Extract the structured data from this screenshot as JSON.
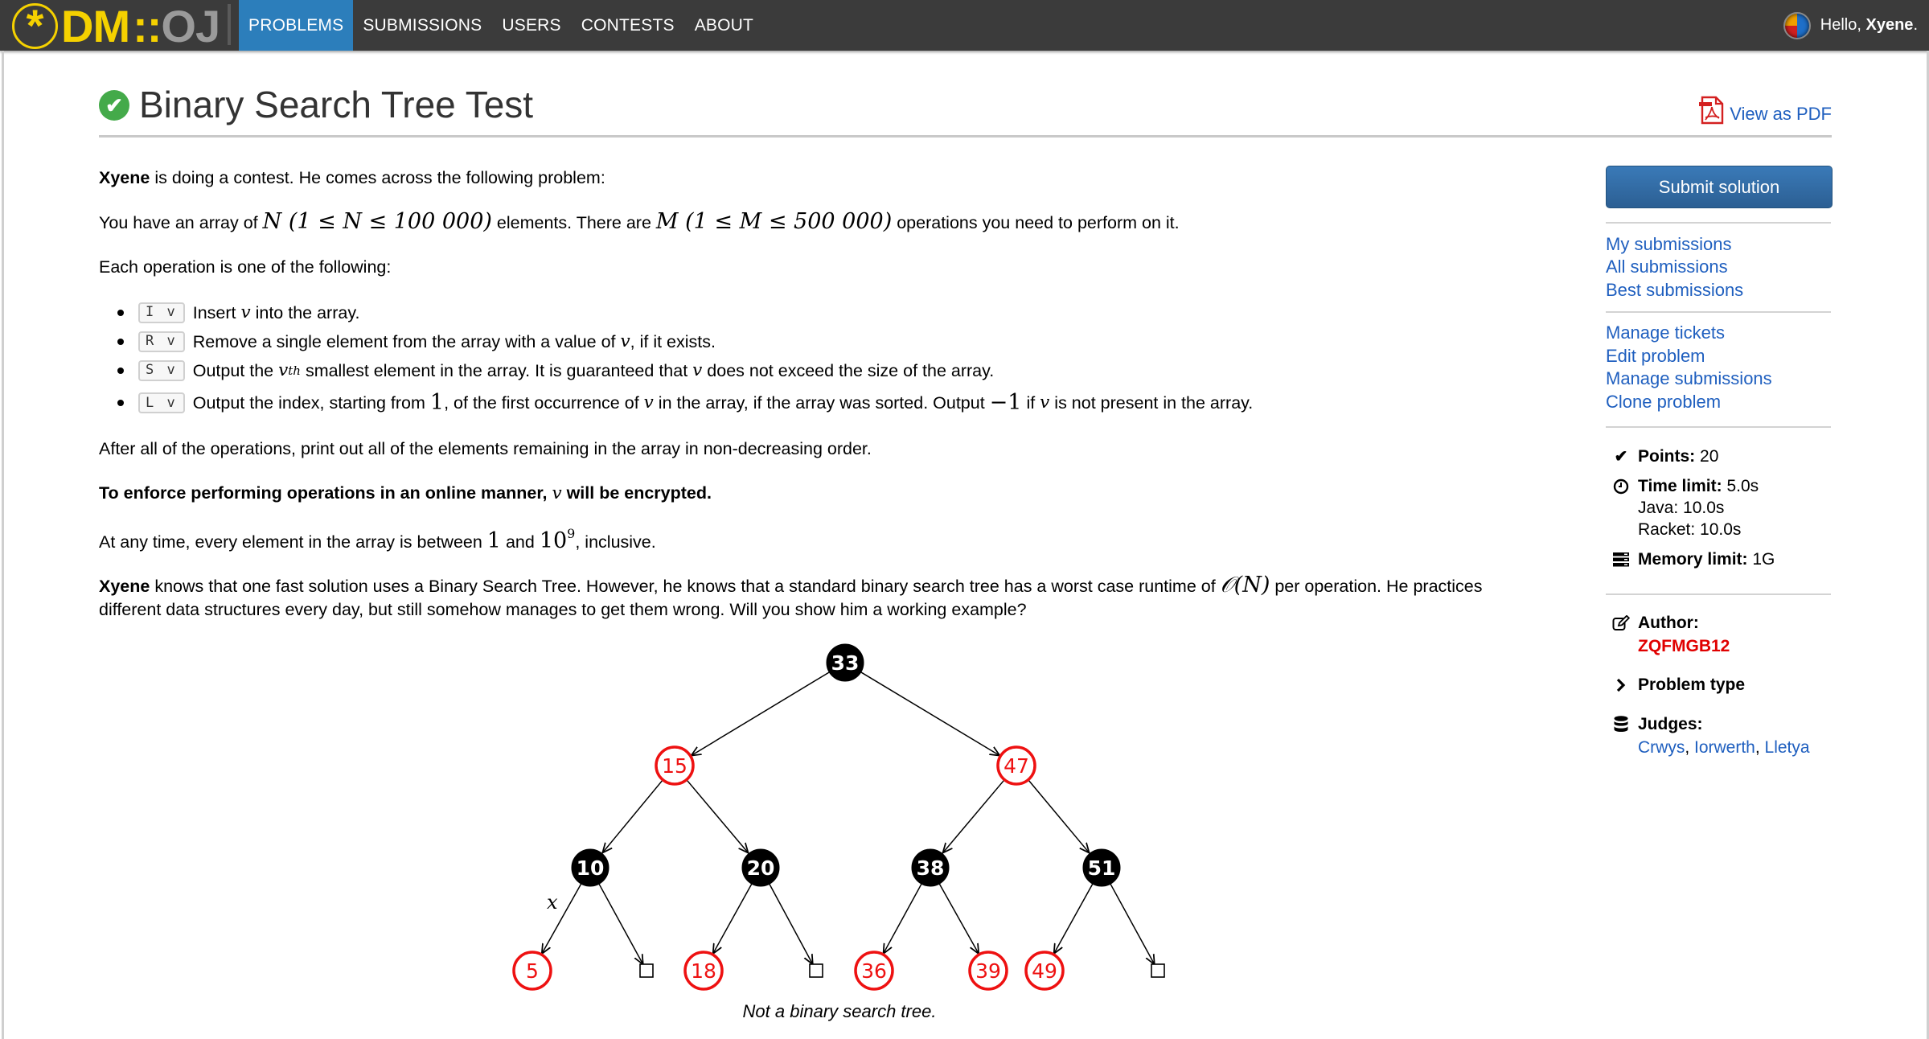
{
  "navbar": {
    "logo": {
      "star": "*",
      "dm": "DM",
      "sep": "::",
      "oj": "OJ"
    },
    "tabs": [
      {
        "label": "PROBLEMS",
        "active": true
      },
      {
        "label": "SUBMISSIONS",
        "active": false
      },
      {
        "label": "USERS",
        "active": false
      },
      {
        "label": "CONTESTS",
        "active": false
      },
      {
        "label": "ABOUT",
        "active": false
      }
    ],
    "greeting_prefix": "Hello, ",
    "username": "Xyene",
    "greeting_suffix": "."
  },
  "title": {
    "icon": "check-circle-icon",
    "text": "Binary Search Tree Test",
    "pdf_label": "View as PDF"
  },
  "statement": {
    "p1_bold": "Xyene",
    "p1_rest": " is doing a contest. He comes across the following problem:",
    "p2_a": "You have an array of ",
    "p2_math1": "N (1 ≤ N ≤ 100 000)",
    "p2_b": " elements. There are ",
    "p2_math2": "M (1 ≤ M ≤ 500 000)",
    "p2_c": " operations you need to perform on it.",
    "p3": "Each operation is one of the following:",
    "operations": [
      {
        "code": "I v",
        "parts": [
          "Insert ",
          "v",
          " into the array."
        ]
      },
      {
        "code": "R v",
        "parts": [
          "Remove a single element from the array with a value of ",
          "v",
          ", if it exists."
        ]
      },
      {
        "code": "S v",
        "parts": [
          "Output the ",
          "v",
          "th",
          " smallest element in the array. It is guaranteed that ",
          "v",
          " does not exceed the size of the array."
        ]
      },
      {
        "code": "L v",
        "parts": [
          "Output the index, starting from ",
          "1",
          ", of the first occurrence of ",
          "v",
          " in the array, if the array was sorted. Output ",
          "−1",
          " if ",
          "v",
          " is not present in the array."
        ]
      }
    ],
    "p4": "After all of the operations, print out all of the elements remaining in the array in non-decreasing order.",
    "p5_a": "To enforce performing operations in an online manner, ",
    "p5_v": "v",
    "p5_b": " will be encrypted.",
    "p6_a": "At any time, every element in the array is between ",
    "p6_one": "1",
    "p6_b": " and ",
    "p6_ten": "10",
    "p6_exp": "9",
    "p6_c": ", inclusive.",
    "p7_bold": "Xyene",
    "p7_a": " knows that one fast solution uses a Binary Search Tree. However, he knows that a standard binary search tree has a worst case runtime of ",
    "p7_math": "𝒪(N)",
    "p7_b": " per operation. He practices",
    "p7_line2": "different data structures every day, but still somehow manages to get them wrong. Will you show him a working example?"
  },
  "tree": {
    "caption": "Not a binary search tree.",
    "edge_label": "x",
    "colors": {
      "black": "#000000",
      "red": "#ee1111"
    },
    "nodes": [
      {
        "id": "n33",
        "value": "33",
        "color": "black",
        "level": 0,
        "slot": 0
      },
      {
        "id": "n15",
        "value": "15",
        "color": "red",
        "level": 1,
        "slot": 0
      },
      {
        "id": "n47",
        "value": "47",
        "color": "red",
        "level": 1,
        "slot": 1
      },
      {
        "id": "n10",
        "value": "10",
        "color": "black",
        "level": 2,
        "slot": 0
      },
      {
        "id": "n20",
        "value": "20",
        "color": "black",
        "level": 2,
        "slot": 1
      },
      {
        "id": "n38",
        "value": "38",
        "color": "black",
        "level": 2,
        "slot": 2
      },
      {
        "id": "n51",
        "value": "51",
        "color": "black",
        "level": 2,
        "slot": 3
      },
      {
        "id": "n5",
        "value": "5",
        "color": "red",
        "level": 3,
        "slot": 0
      },
      {
        "id": "nil1",
        "value": "",
        "color": "nil",
        "level": 3,
        "slot": 1
      },
      {
        "id": "n18",
        "value": "18",
        "color": "red",
        "level": 3,
        "slot": 2
      },
      {
        "id": "nil2",
        "value": "",
        "color": "nil",
        "level": 3,
        "slot": 3
      },
      {
        "id": "n36",
        "value": "36",
        "color": "red",
        "level": 3,
        "slot": 4
      },
      {
        "id": "n39",
        "value": "39",
        "color": "red",
        "level": 3,
        "slot": 5
      },
      {
        "id": "n49",
        "value": "49",
        "color": "red",
        "level": 3,
        "slot": 6
      },
      {
        "id": "nil3",
        "value": "",
        "color": "nil",
        "level": 3,
        "slot": 7
      }
    ],
    "edges": [
      [
        "n33",
        "n15"
      ],
      [
        "n33",
        "n47"
      ],
      [
        "n15",
        "n10"
      ],
      [
        "n15",
        "n20"
      ],
      [
        "n47",
        "n38"
      ],
      [
        "n47",
        "n51"
      ],
      [
        "n10",
        "n5"
      ],
      [
        "n10",
        "nil1"
      ],
      [
        "n20",
        "n18"
      ],
      [
        "n20",
        "nil2"
      ],
      [
        "n38",
        "n36"
      ],
      [
        "n38",
        "n39"
      ],
      [
        "n51",
        "n49"
      ],
      [
        "n51",
        "nil3"
      ]
    ]
  },
  "sidebar": {
    "submit_label": "Submit solution",
    "links_group1": [
      "My submissions",
      "All submissions",
      "Best submissions"
    ],
    "links_group2": [
      "Manage tickets",
      "Edit problem",
      "Manage submissions",
      "Clone problem"
    ],
    "points_label": "Points:",
    "points_value": "20",
    "time_label": "Time limit:",
    "time_value": "5.0s",
    "time_overrides": [
      "Java: 10.0s",
      "Racket: 10.0s"
    ],
    "memory_label": "Memory limit:",
    "memory_value": "1G",
    "author_label": "Author:",
    "author_name": "ZQFMGB12",
    "problem_type_label": "Problem type",
    "judges_label": "Judges:",
    "judges": [
      "Crwys",
      "Iorwerth",
      "Lletya"
    ],
    "author_color": "#e00000",
    "link_color": "#1f5fbf"
  }
}
